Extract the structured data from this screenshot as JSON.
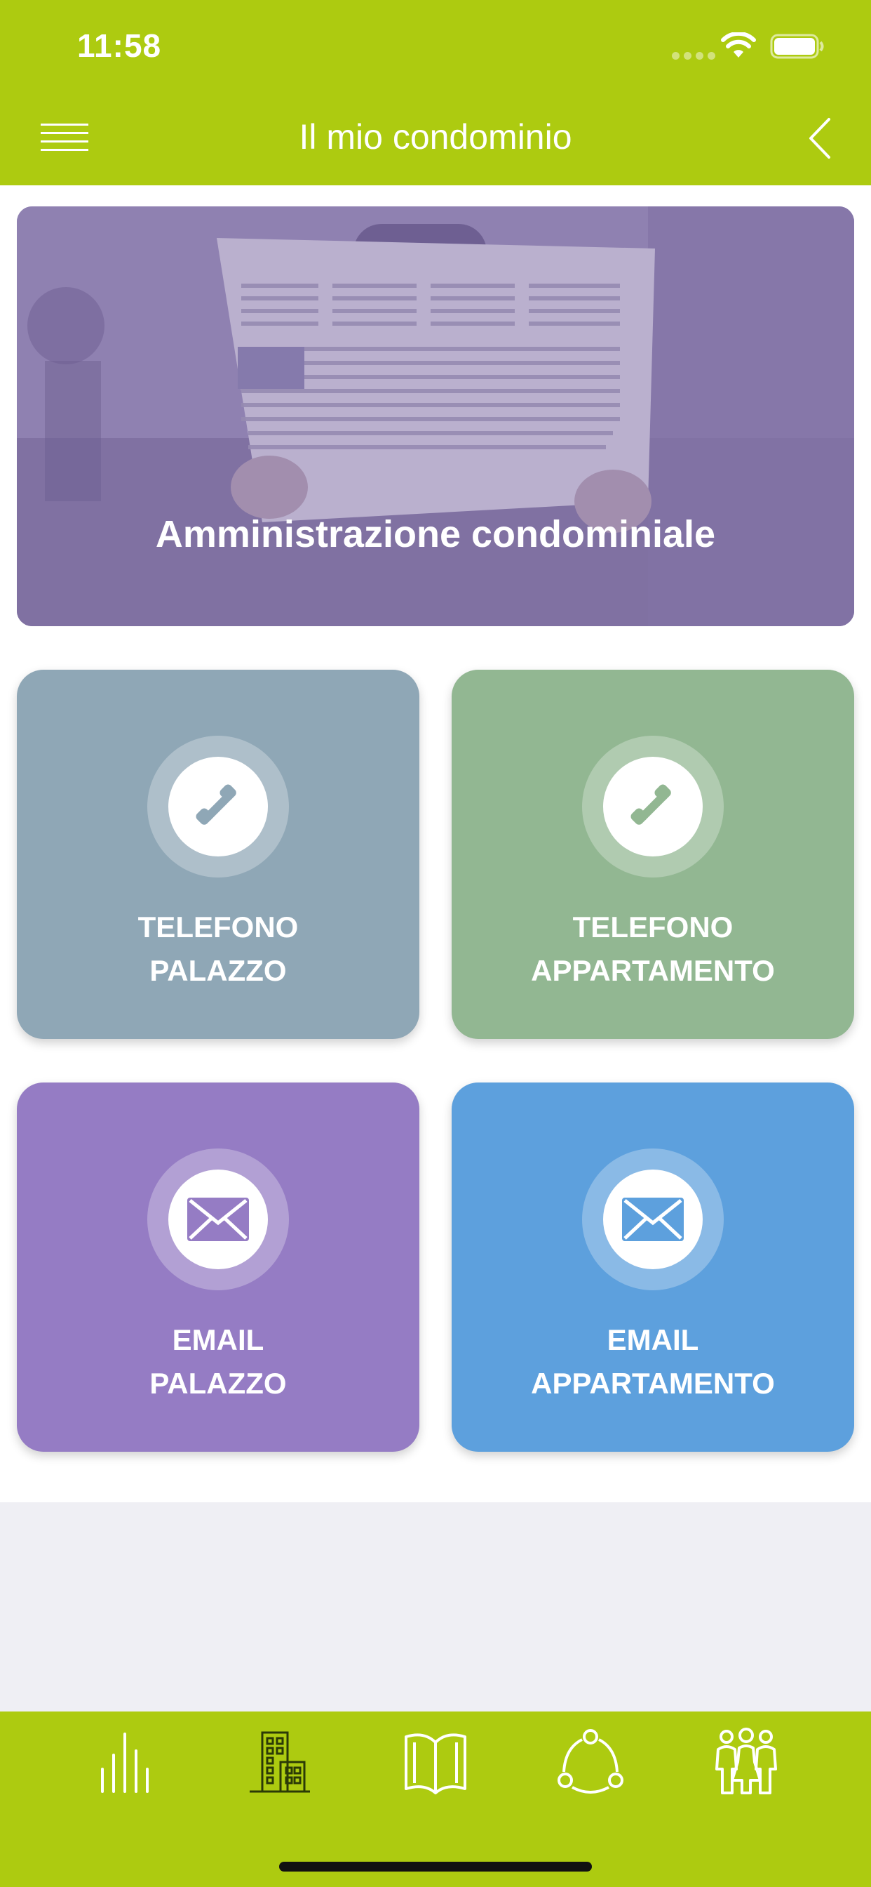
{
  "status_bar": {
    "time": "11:58"
  },
  "nav": {
    "title": "Il mio condominio"
  },
  "banner": {
    "label": "Amministrazione condominiale"
  },
  "tiles": [
    {
      "line1": "TELEFONO",
      "line2": "PALAZZO",
      "icon": "phone-icon",
      "color": "#8fa7b6"
    },
    {
      "line1": "TELEFONO",
      "line2": "APPARTAMENTO",
      "icon": "phone-icon",
      "color": "#92b792"
    },
    {
      "line1": "EMAIL",
      "line2": "PALAZZO",
      "icon": "mail-icon",
      "color": "#957cc4"
    },
    {
      "line1": "EMAIL",
      "line2": "APPARTAMENTO",
      "icon": "mail-icon",
      "color": "#5da0dd"
    }
  ],
  "tabbar": {
    "items": [
      {
        "icon": "chart-bars-icon",
        "selected": false
      },
      {
        "icon": "building-icon",
        "selected": true
      },
      {
        "icon": "book-icon",
        "selected": false
      },
      {
        "icon": "share-network-icon",
        "selected": false
      },
      {
        "icon": "people-icon",
        "selected": false
      }
    ]
  },
  "colors": {
    "brand": "#adcb10",
    "background": "#efeff4"
  }
}
